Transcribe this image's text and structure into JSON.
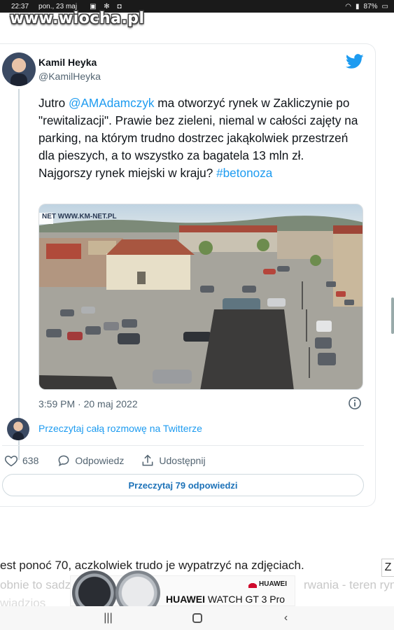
{
  "status_bar": {
    "time": "22:37",
    "date": "pon., 23 maj",
    "battery": "87%"
  },
  "watermark": "www.wiocha.pl",
  "tweet": {
    "author_name": "Kamil Heyka",
    "author_handle": "@KamilHeyka",
    "text_prefix": "Jutro ",
    "mention": "@AMAdamczyk",
    "text_body": " ma otworzyć rynek w Zakliczynie po \"rewitalizacji\". Prawie bez zieleni, niemal w całości zajęty na parking, na którym trudno dostrzec jakąkolwiek przestrzeń dla pieszych, a to wszystko za bagatela 13 mln zł. Najgorszy rynek miejski w kraju? ",
    "hashtag": "#betonoza",
    "photo_watermark": "NET  WWW.KM-NET.PL",
    "timestamp": "3:59 PM · 20 maj 2022",
    "read_conversation": "Przeczytaj całą rozmowę na Twitterze",
    "likes": "638",
    "reply_label": "Odpowiedz",
    "share_label": "Udostępnij",
    "read_replies": "Przeczytaj 79 odpowiedzi"
  },
  "article": {
    "caption": "est ponoć 70, aczkolwiek trudo je wypatrzyć na zdjęciach.",
    "faded_line": "obnie to sadz",
    "faded_line_right": "rwania - teren ryn",
    "faded_line_2": "wiadzios",
    "side_tab": "Z"
  },
  "ad": {
    "brand": "HUAWEI",
    "product_bold": "HUAWEI",
    "product_rest": " WATCH GT 3 Pro"
  },
  "colors": {
    "link_blue": "#1d9bf0",
    "replies_blue": "#1d72b8",
    "huawei_red": "#cf0a2c"
  },
  "icons": [
    "twitter-bird-icon",
    "info-icon",
    "heart-icon",
    "reply-bubble-icon",
    "share-icon",
    "wifi-icon",
    "signal-icon",
    "battery-icon",
    "recents-icon",
    "home-icon",
    "back-icon"
  ]
}
